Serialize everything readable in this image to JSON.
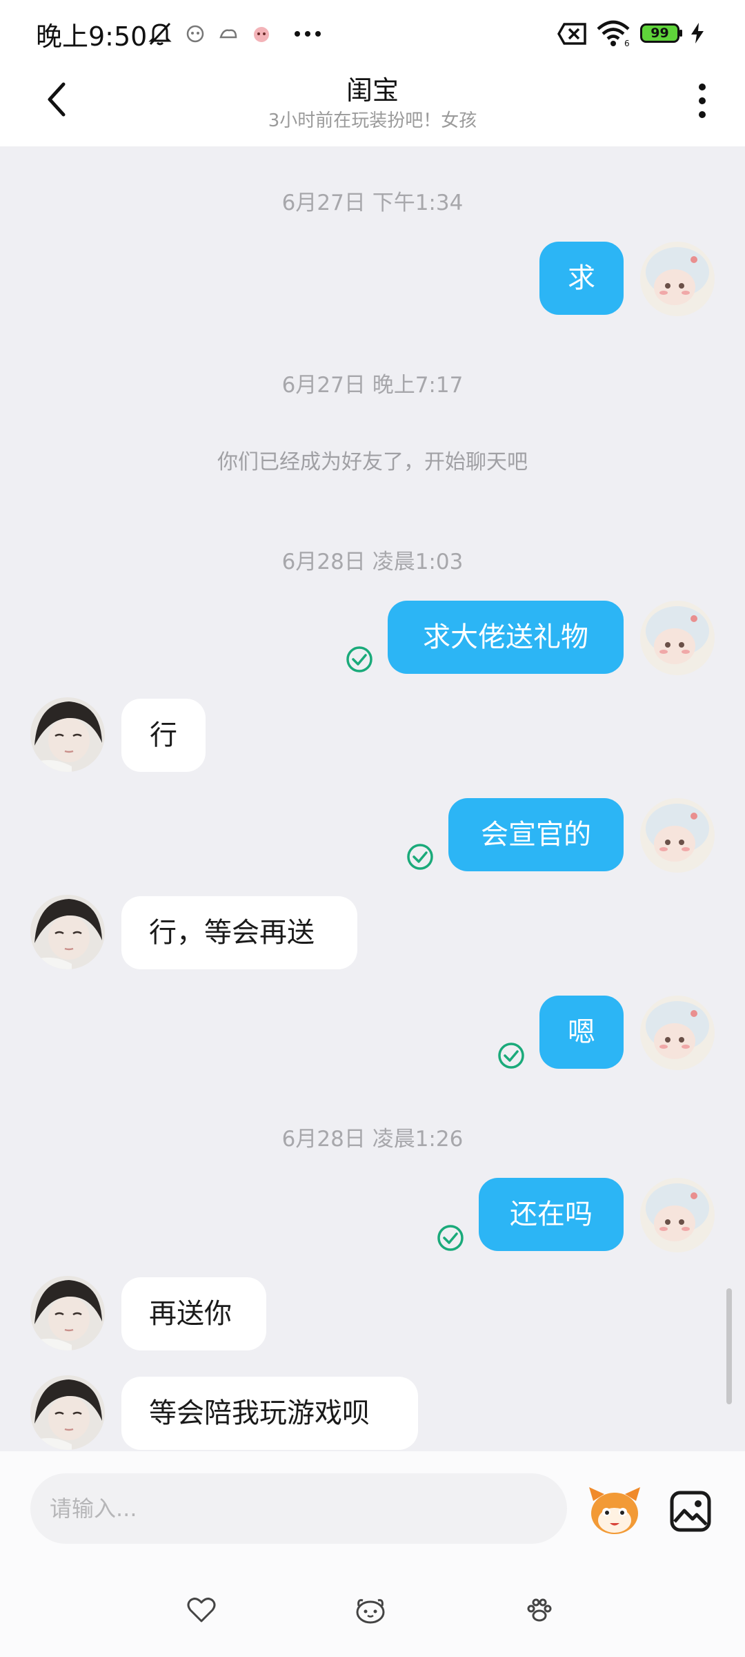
{
  "status": {
    "time": "晚上9:50",
    "battery": "99"
  },
  "header": {
    "title": "闺宝",
    "subtitle": "3小时前在玩装扮吧！女孩"
  },
  "chat": {
    "ts1": "6月27日 下午1:34",
    "ts2": "6月27日 晚上7:17",
    "system": "你们已经成为好友了，开始聊天吧",
    "ts3": "6月28日 凌晨1:03",
    "ts4": "6月28日 凌晨1:26",
    "m1": "求",
    "m2": "求大佬送礼物",
    "m3": "行",
    "m4": "会宣官的",
    "m5": "行，等会再送",
    "m6": "嗯",
    "m7": "还在吗",
    "m8": "再送你",
    "m9": "等会陪我玩游戏呗"
  },
  "input": {
    "placeholder": "请输入..."
  },
  "colors": {
    "accent": "#2cb5f5",
    "read_check": "#1aaa7a",
    "chat_bg": "#efeff3"
  },
  "icons": [
    "back-arrow-icon",
    "more-vertical-icon",
    "bell-off-icon",
    "wifi-icon",
    "battery-icon",
    "charging-icon",
    "sim-off-icon",
    "read-check-icon",
    "mascot-emoji-icon",
    "image-picture-icon",
    "heart-icon",
    "face-icon",
    "paw-icon"
  ]
}
